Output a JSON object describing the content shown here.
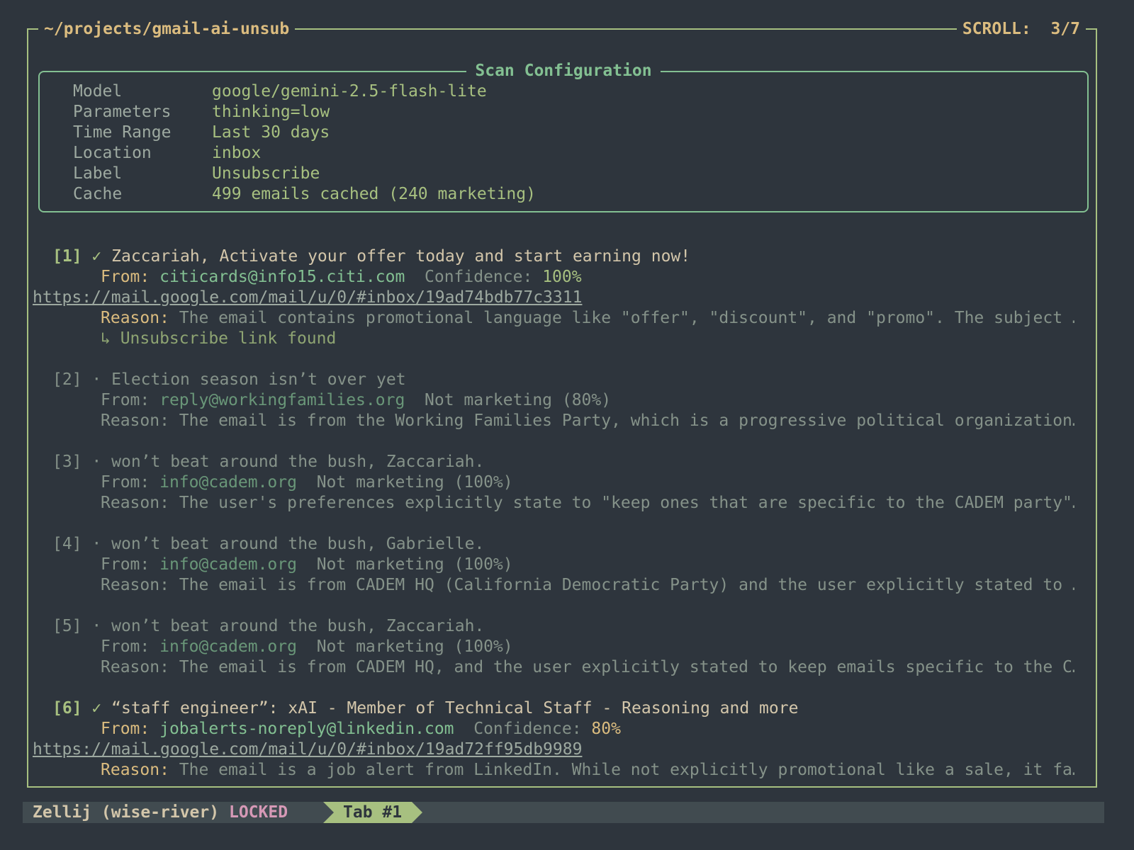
{
  "pane": {
    "title": "~/projects/gmail-ai-unsub",
    "scroll_label": "SCROLL:",
    "scroll_value": "3/7"
  },
  "config": {
    "title": "Scan Configuration",
    "rows": [
      {
        "key": "Model",
        "value": "google/gemini-2.5-flash-lite"
      },
      {
        "key": "Parameters",
        "value": "thinking=low"
      },
      {
        "key": "Time Range",
        "value": "Last 30 days"
      },
      {
        "key": "Location",
        "value": "inbox"
      },
      {
        "key": "Label",
        "value": "Unsubscribe"
      },
      {
        "key": "Cache",
        "value": "499 emails cached (240 marketing)"
      }
    ]
  },
  "emails": [
    {
      "index": "[1]",
      "mark": "✓",
      "subject": "Zaccariah, Activate your offer today and start earning now!",
      "from_label": "From:",
      "from": "citicards@info15.citi.com",
      "verdict_label": "Confidence:",
      "verdict_value": "100%",
      "url": "https://mail.google.com/mail/u/0/#inbox/19ad74bdb77c3311",
      "reason_label": "Reason:",
      "reason": "The email contains promotional language like \"offer\", \"discount\", and \"promo\". The subject …",
      "unsub": "↳ Unsubscribe link found"
    },
    {
      "index": "[2]",
      "mark": "·",
      "subject": "Election season isn’t over yet",
      "from_label": "From:",
      "from": "reply@workingfamilies.org",
      "verdict": "Not marketing (80%)",
      "reason_label": "Reason:",
      "reason": "The email is from the Working Families Party, which is a progressive political organization…"
    },
    {
      "index": "[3]",
      "mark": "·",
      "subject": "won’t beat around the bush, Zaccariah.",
      "from_label": "From:",
      "from": "info@cadem.org",
      "verdict": "Not marketing (100%)",
      "reason_label": "Reason:",
      "reason": "The user's preferences explicitly state to \"keep ones that are specific to the CADEM party\"…"
    },
    {
      "index": "[4]",
      "mark": "·",
      "subject": "won’t beat around the bush, Gabrielle.",
      "from_label": "From:",
      "from": "info@cadem.org",
      "verdict": "Not marketing (100%)",
      "reason_label": "Reason:",
      "reason": "The email is from CADEM HQ (California Democratic Party) and the user explicitly stated to …"
    },
    {
      "index": "[5]",
      "mark": "·",
      "subject": "won’t beat around the bush, Zaccariah.",
      "from_label": "From:",
      "from": "info@cadem.org",
      "verdict": "Not marketing (100%)",
      "reason_label": "Reason:",
      "reason": "The email is from CADEM HQ, and the user explicitly stated to keep emails specific to the C…"
    },
    {
      "index": "[6]",
      "mark": "✓",
      "subject": "“staff engineer”: xAI - Member of Technical Staff - Reasoning and more",
      "from_label": "From:",
      "from": "jobalerts-noreply@linkedin.com",
      "verdict_label": "Confidence:",
      "verdict_value": "80%",
      "url": "https://mail.google.com/mail/u/0/#inbox/19ad72ff95db9989",
      "reason_label": "Reason:",
      "reason": "The email is a job alert from LinkedIn. While not explicitly promotional like a sale, it fa…"
    }
  ],
  "statusbar": {
    "session": "Zellij (wise-river)",
    "mode": "LOCKED",
    "tab": "Tab #1"
  },
  "colors": {
    "background": "#2e353d",
    "frame": "#a7c080",
    "config_border": "#83c092",
    "confidence_high": "#a7c080",
    "confidence_medium": "#dbbc7f",
    "locked": "#d699b6"
  }
}
